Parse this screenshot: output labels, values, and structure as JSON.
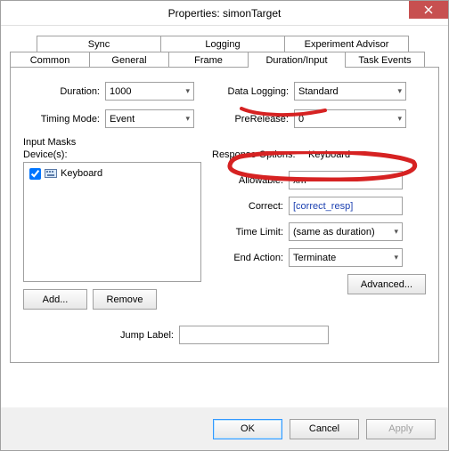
{
  "window": {
    "title": "Properties: simonTarget"
  },
  "tabs": {
    "row1": [
      "Sync",
      "Logging",
      "Experiment Advisor"
    ],
    "row2": [
      "Common",
      "General",
      "Frame",
      "Duration/Input",
      "Task Events"
    ],
    "active": "Duration/Input"
  },
  "duration": {
    "label": "Duration:",
    "value": "1000"
  },
  "dataLogging": {
    "label": "Data Logging:",
    "value": "Standard"
  },
  "timingMode": {
    "label": "Timing Mode:",
    "value": "Event"
  },
  "preRelease": {
    "label": "PreRelease:",
    "value": "0"
  },
  "inputMasks": {
    "label": "Input Masks",
    "devicesLabel": "Device(s):",
    "devices": [
      {
        "checked": true,
        "name": "Keyboard"
      }
    ],
    "addLabel": "Add...",
    "removeLabel": "Remove"
  },
  "responseOptions": {
    "label": "Response Options:",
    "value": "Keyboard",
    "allowable": {
      "label": "Allowable:",
      "value": "xm"
    },
    "correct": {
      "label": "Correct:",
      "value": "[correct_resp]"
    },
    "timeLimit": {
      "label": "Time Limit:",
      "value": "(same as duration)"
    },
    "endAction": {
      "label": "End Action:",
      "value": "Terminate"
    },
    "advancedLabel": "Advanced..."
  },
  "jumpLabel": {
    "label": "Jump Label:",
    "value": ""
  },
  "footer": {
    "ok": "OK",
    "cancel": "Cancel",
    "apply": "Apply"
  }
}
